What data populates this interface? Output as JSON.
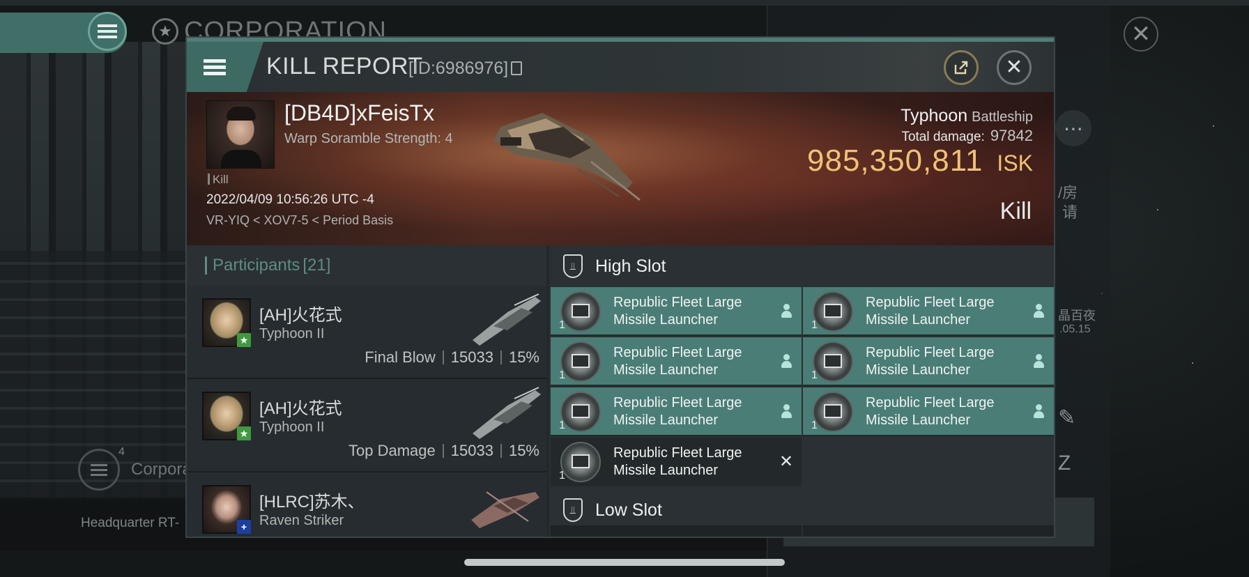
{
  "background": {
    "corp_title": "CORPORATION",
    "side_text_1": "/房",
    "side_text_2": "请",
    "side_text_3": "晶百夜",
    "side_text_4": ".05.15",
    "corp_sub_badge": "4",
    "corp_sub_label": "Corpora",
    "hq_label": "Headquarter RT-"
  },
  "header": {
    "title": "KILL REPORT",
    "id": "[ID:6986976]"
  },
  "victim": {
    "name": "[DB4D]xFeisTx",
    "subtitle": "Warp Soramble Strength: 4",
    "kill_tag": "Kill",
    "datetime": "2022/04/09 10:56:26 UTC -4",
    "location": "VR-YIQ < XOV7-5 < Period Basis",
    "ship": "Typhoon",
    "ship_class": "Battleship",
    "total_damage_label": "Total damage:",
    "total_damage": "97842",
    "isk_value": "985,350,811",
    "isk_unit": "ISK",
    "result": "Kill"
  },
  "participants": {
    "label": "Participants",
    "count": "[21]",
    "rows": [
      {
        "name": "[AH]火花式",
        "ship": "Typhoon II",
        "stat_label": "Final Blow",
        "damage": "15033",
        "percent": "15%",
        "badge": "★"
      },
      {
        "name": "[AH]火花式",
        "ship": "Typhoon II",
        "stat_label": "Top Damage",
        "damage": "15033",
        "percent": "15%",
        "badge": "★"
      },
      {
        "name": "[HLRC]苏木、",
        "ship": "Raven Striker",
        "badge": "+"
      }
    ]
  },
  "fittings": {
    "high_slot_label": "High Slot",
    "low_slot_label": "Low Slot",
    "high_modules": [
      {
        "name": "Republic Fleet Large Missile Launcher",
        "qty": "1",
        "state": "fitted"
      },
      {
        "name": "Republic Fleet Large Missile Launcher",
        "qty": "1",
        "state": "fitted"
      },
      {
        "name": "Republic Fleet Large Missile Launcher",
        "qty": "1",
        "state": "fitted"
      },
      {
        "name": "Republic Fleet Large Missile Launcher",
        "qty": "1",
        "state": "fitted"
      },
      {
        "name": "Republic Fleet Large Missile Launcher",
        "qty": "1",
        "state": "fitted"
      },
      {
        "name": "Republic Fleet Large Missile Launcher",
        "qty": "1",
        "state": "fitted"
      },
      {
        "name": "Republic Fleet Large Missile Launcher",
        "qty": "1",
        "state": "destroyed"
      }
    ]
  },
  "colors": {
    "accent": "#4a7d75",
    "isk": "#f0c277",
    "banner": "#4a2820"
  }
}
